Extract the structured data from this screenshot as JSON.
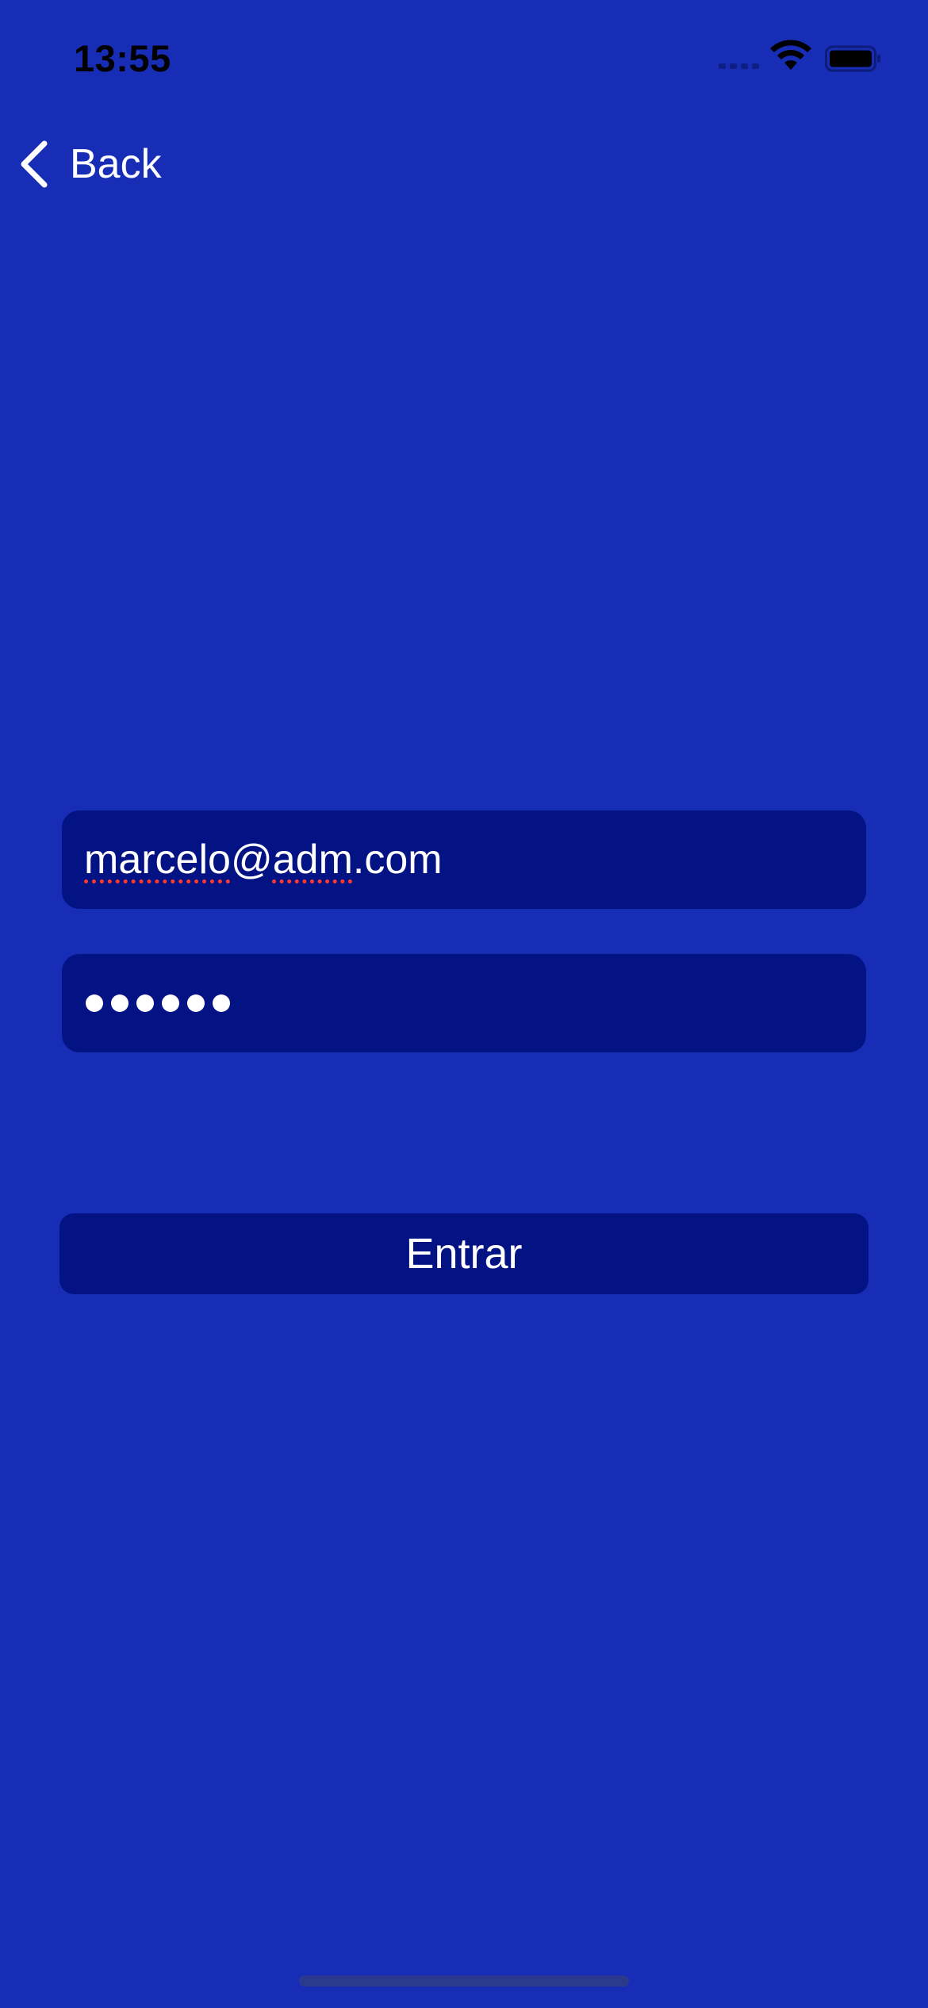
{
  "status_bar": {
    "time": "13:55"
  },
  "nav": {
    "back_label": "Back"
  },
  "form": {
    "email_value_parts": [
      "marcelo",
      "@",
      "adm",
      ".com"
    ],
    "password_value": "••••••",
    "submit_label": "Entrar"
  },
  "colors": {
    "background": "#182db5",
    "field_background": "#031384",
    "spellcheck_underline": "#ff3b30"
  }
}
